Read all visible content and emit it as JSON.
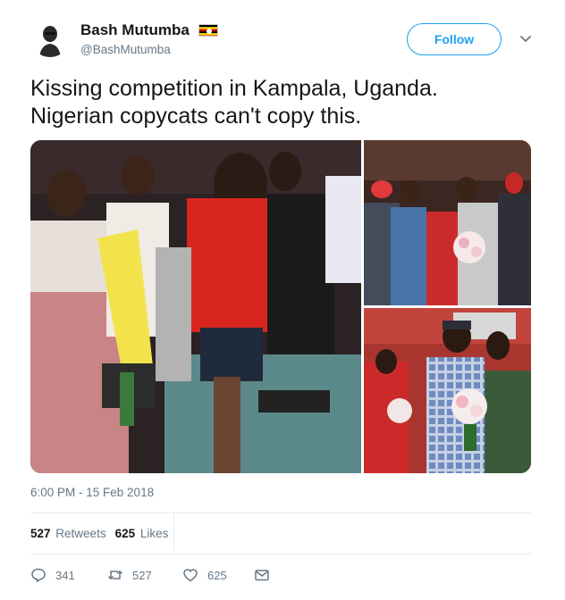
{
  "user": {
    "display_name": "Bash Mutumba",
    "handle": "@BashMutumba",
    "flag_icon": "uganda-flag-icon"
  },
  "follow_label": "Follow",
  "tweet": {
    "line1": "Kissing competition in Kampala, Uganda.",
    "line2": "Nigerian copycats can't copy this."
  },
  "timestamp": "6:00 PM - 15 Feb 2018",
  "stats": {
    "retweets_count": "527",
    "retweets_label": "Retweets",
    "likes_count": "625",
    "likes_label": "Likes"
  },
  "actions": {
    "reply_count": "341",
    "retweet_count": "527",
    "like_count": "625"
  },
  "colors": {
    "accent": "#1da1f2",
    "secondary_text": "#657786",
    "divider": "#e6ecf0"
  }
}
